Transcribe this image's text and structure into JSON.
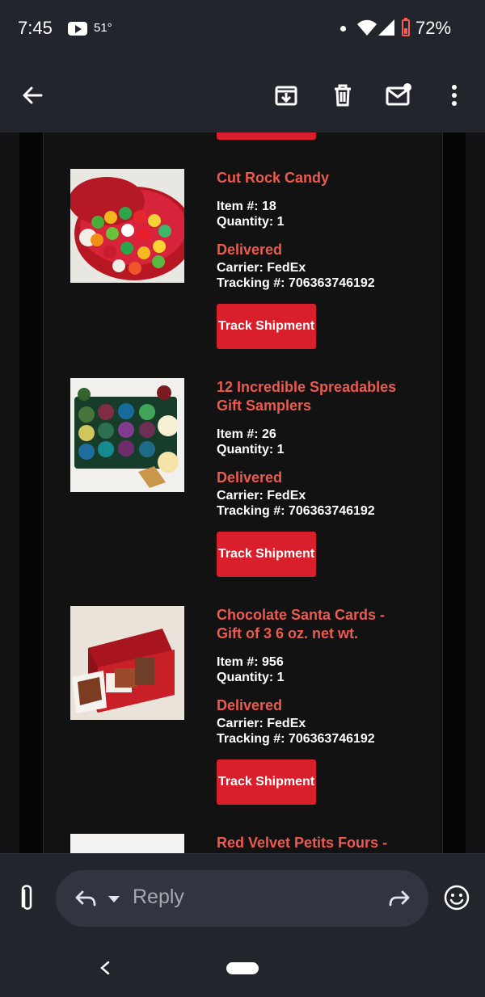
{
  "status_bar": {
    "time": "7:45",
    "temperature": "51°",
    "battery": "72%",
    "icons": [
      "youtube-icon",
      "wifi-icon",
      "signal-icon",
      "battery-icon"
    ]
  },
  "app_bar": {
    "back": "arrow-left-icon",
    "actions": [
      "archive-icon",
      "delete-icon",
      "mark-unread-icon",
      "more-vertical-icon"
    ]
  },
  "products": [
    {
      "title": "Cut Rock Candy",
      "item": "Item #: 18",
      "quantity": "Quantity: 1",
      "status": "Delivered",
      "carrier": "Carrier: FedEx",
      "tracking": "Tracking #: 706363746192",
      "button": "Track Shipment"
    },
    {
      "title": "12 Incredible Spreadables Gift Samplers",
      "item": "Item #: 26",
      "quantity": "Quantity: 1",
      "status": "Delivered",
      "carrier": "Carrier: FedEx",
      "tracking": "Tracking #: 706363746192",
      "button": "Track Shipment"
    },
    {
      "title": "Chocolate Santa Cards - Gift of 3 6 oz. net wt.",
      "item": "Item #: 956",
      "quantity": "Quantity: 1",
      "status": "Delivered",
      "carrier": "Carrier: FedEx",
      "tracking": "Tracking #: 706363746192",
      "button": "Track Shipment"
    },
    {
      "title": "Red Velvet Petits Fours -"
    }
  ],
  "compose": {
    "reply_placeholder": "Reply",
    "icons": [
      "attach-icon",
      "reply-icon",
      "forward-icon",
      "emoji-icon"
    ]
  },
  "colors": {
    "background": "#111214",
    "accent": "#ed5a4f",
    "button": "#d81f2b",
    "bar": "#22252c"
  }
}
